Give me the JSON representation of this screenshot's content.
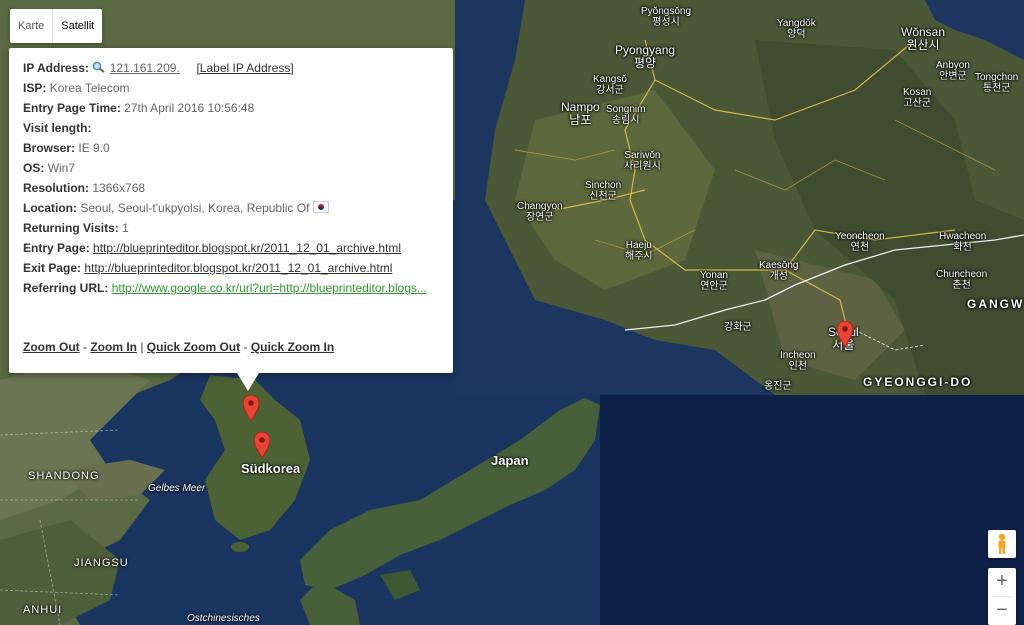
{
  "map_type": {
    "map_label": "Karte",
    "satellite_label": "Satellit"
  },
  "info": {
    "ip_label": "IP Address:",
    "ip_value": "121.161.209.",
    "label_ip_link": "[Label IP Address]",
    "isp_label": "ISP:",
    "isp_value": "Korea Telecom",
    "entry_time_label": "Entry Page Time:",
    "entry_time_value": "27th April 2016 10:56:48",
    "visit_length_label": "Visit length:",
    "browser_label": "Browser:",
    "browser_value": "IE 9.0",
    "os_label": "OS:",
    "os_value": "Win7",
    "resolution_label": "Resolution:",
    "resolution_value": "1366x768",
    "location_label": "Location:",
    "location_value": "Seoul, Seoul-t'ukpyolsi, Korea, Republic Of",
    "returning_label": "Returning Visits:",
    "returning_value": "1",
    "entry_page_label": "Entry Page:",
    "entry_page_value": "http://blueprinteditor.blogspot.kr/2011_12_01_archive.html",
    "exit_page_label": "Exit Page:",
    "exit_page_value": "http://blueprinteditor.blogspot.kr/2011_12_01_archive.html",
    "referring_label": "Referring URL:",
    "referring_value": "http://www.google.co.kr/url?url=http://blueprinteditor.blogs..."
  },
  "zoom_links": {
    "zoom_out": "Zoom Out",
    "sep1": " - ",
    "zoom_in": "Zoom In",
    "sep2": " | ",
    "quick_zoom_out": "Quick Zoom Out",
    "sep3": " - ",
    "quick_zoom_in": "Quick Zoom In"
  },
  "base_map_labels": {
    "suedkorea": "Südkorea",
    "japan": "Japan",
    "shandong": "SHANDONG",
    "jiangsu": "JIANGSU",
    "anhui": "ANHUI",
    "gelbes_meer": "Gelbes Meer",
    "ostchinesisches": "Ostchinesisches"
  },
  "inset_labels": {
    "pyongsong": "Pyŏngsŏng\n평성시",
    "yangdok": "Yangdŏk\n양덕",
    "wonsan": "Wŏnsan\n원산시",
    "pyongyang": "Pyongyang\n평양",
    "anbyon": "Anbyon\n안변군",
    "tongchon": "Tongchon\n통천군",
    "kangso": "Kangsŏ\n강서군",
    "kosan": "Kosan\n고산군",
    "nampo": "Nampo\n남포",
    "songnim": "Songnim\n송림시",
    "sariwon": "Sariwŏn\n사리원시",
    "sinchon": "Sinchon\n신천군",
    "changyon": "Changyon\n장연군",
    "yeoncheon": "Yeoncheon\n연천",
    "hwacheon": "Hwacheon\n화천",
    "haeju": "Haeju\n해주시",
    "kaesong": "Kaesŏng\n개성",
    "chuncheon": "Chuncheon\n춘천",
    "yonan": "Yonan\n연안군",
    "gangw": "GANGW",
    "ganghwa": "강화군",
    "seoul": "Seoul\n서울",
    "incheon": "Incheon\n인천",
    "gyeonggi": "GYEONGGI-DO",
    "onggin": "옹진군"
  },
  "controls": {
    "zoom_in": "+",
    "zoom_out": "−"
  },
  "icons": {
    "magnifier": "search-icon",
    "flag": "flag-south-korea-icon",
    "pegman": "pegman-icon",
    "marker": "map-marker-icon"
  }
}
